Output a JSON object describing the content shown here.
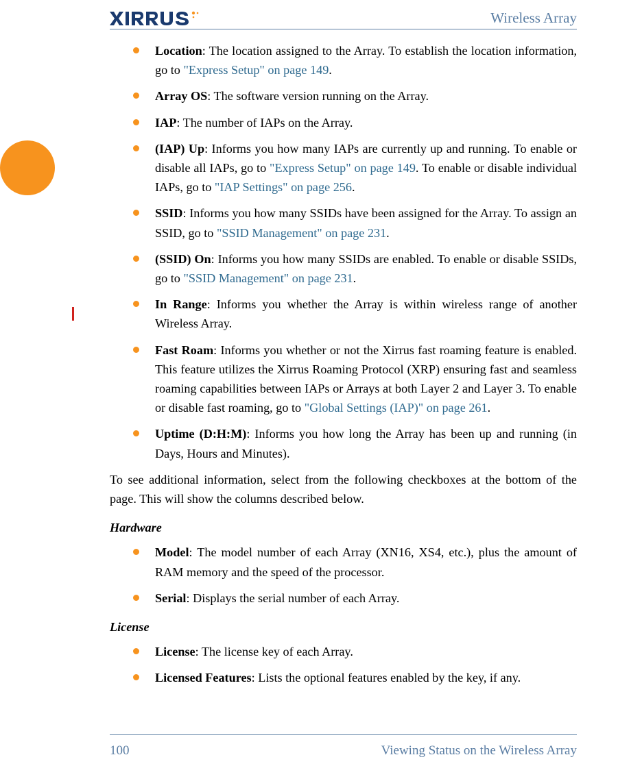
{
  "header": {
    "brand": "XIRRUS",
    "title": "Wireless Array"
  },
  "items": [
    {
      "bold": "Location",
      "rest1": ": The location assigned to the Array. To establish the location information, go to ",
      "link1": "\"Express Setup\" on page 149",
      "rest2": ".",
      "link2": "",
      "rest3": "",
      "link3": "",
      "rest4": ""
    },
    {
      "bold": "Array OS",
      "rest1": ": The software version running on the Array.",
      "link1": "",
      "rest2": "",
      "link2": "",
      "rest3": "",
      "link3": "",
      "rest4": ""
    },
    {
      "bold": "IAP",
      "rest1": ": The number of IAPs on the Array.",
      "link1": "",
      "rest2": "",
      "link2": "",
      "rest3": "",
      "link3": "",
      "rest4": ""
    },
    {
      "bold": "(IAP) Up",
      "rest1": ": Informs you how many IAPs are currently up and running. To enable or disable all IAPs, go to ",
      "link1": "\"Express Setup\" on page 149",
      "rest2": ". To enable or disable individual IAPs, go to ",
      "link2": "\"IAP Settings\" on page 256",
      "rest3": ".",
      "link3": "",
      "rest4": ""
    },
    {
      "bold": "SSID",
      "rest1": ": Informs you how many SSIDs have been assigned for the Array. To assign an SSID, go to ",
      "link1": "\"SSID Management\" on page 231",
      "rest2": ".",
      "link2": "",
      "rest3": "",
      "link3": "",
      "rest4": ""
    },
    {
      "bold": "(SSID) On",
      "rest1": ": Informs you how many SSIDs are enabled. To enable or disable SSIDs, go to ",
      "link1": "\"SSID Management\" on page 231",
      "rest2": ".",
      "link2": "",
      "rest3": "",
      "link3": "",
      "rest4": ""
    },
    {
      "bold": "In Range",
      "rest1": ": Informs you whether the Array is within wireless range of another Wireless Array.",
      "link1": "",
      "rest2": "",
      "link2": "",
      "rest3": "",
      "link3": "",
      "rest4": ""
    },
    {
      "bold": "Fast Roam",
      "rest1": ": Informs you whether or not the Xirrus fast roaming feature is enabled. This feature utilizes the Xirrus Roaming Protocol (XRP) ensuring fast and seamless roaming capabilities between IAPs or Arrays at both Layer 2 and Layer 3. To enable or disable fast roaming, go to ",
      "link1": "\"Global Settings (IAP)\" on page 261",
      "rest2": ".",
      "link2": "",
      "rest3": "",
      "link3": "",
      "rest4": ""
    },
    {
      "bold": "Uptime (D:H:M)",
      "rest1": ": Informs you how long the Array has been up and running (in Days, Hours and Minutes).",
      "link1": "",
      "rest2": "",
      "link2": "",
      "rest3": "",
      "link3": "",
      "rest4": ""
    }
  ],
  "para1": "To see additional information, select from the following checkboxes at the bottom of the page. This will show the columns described below.",
  "sections": {
    "hardware": {
      "heading": "Hardware",
      "items": [
        {
          "bold": "Model",
          "rest1": ": The model number of each Array (XN16, XS4, etc.), plus the amount of RAM memory and the speed of the processor."
        },
        {
          "bold": "Serial",
          "rest1": ": Displays the serial number of each Array."
        }
      ]
    },
    "license": {
      "heading": "License",
      "items": [
        {
          "bold": "License",
          "rest1": ": The license key of each Array."
        },
        {
          "bold": "Licensed Features",
          "rest1": ": Lists the optional features enabled by the key, if any."
        }
      ]
    }
  },
  "footer": {
    "page": "100",
    "section": "Viewing Status on the Wireless Array"
  }
}
